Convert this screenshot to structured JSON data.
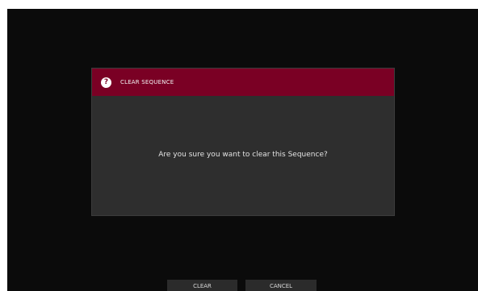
{
  "dialog": {
    "title": "CLEAR SEQUENCE",
    "help_icon": "?",
    "message": "Are you sure you want to clear this Sequence?"
  },
  "buttons": {
    "clear_label": "CLEAR",
    "cancel_label": "CANCEL"
  },
  "colors": {
    "header": "#7a0024",
    "dialog_body": "#2e2e2e",
    "screen_background": "#0b0b0b"
  }
}
